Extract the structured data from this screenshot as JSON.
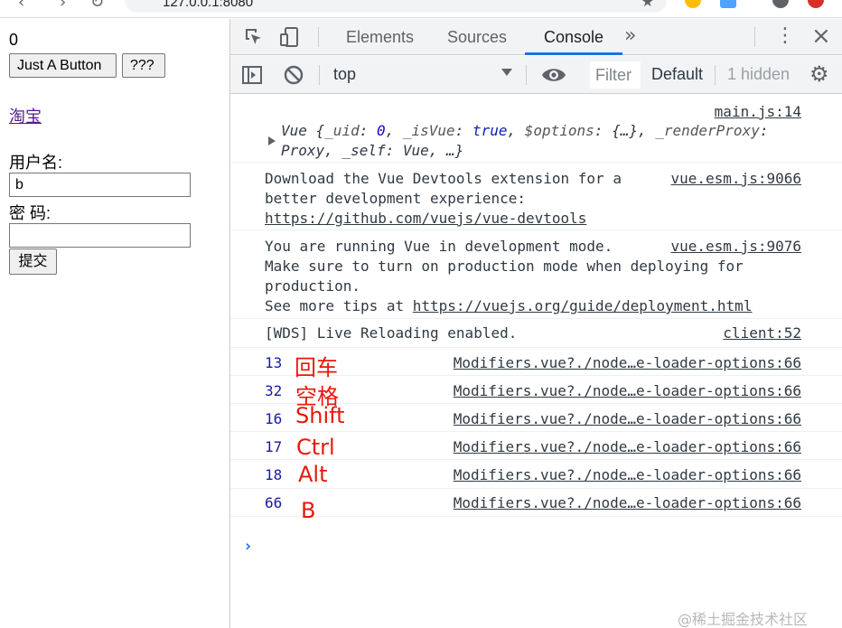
{
  "browser": {
    "url": "127.0.0.1:8080"
  },
  "page": {
    "counter": "0",
    "button1_label": "Just A Button",
    "button2_label": "???",
    "link_text": "淘宝",
    "username_label": "用户名:",
    "username_value": "b",
    "password_label": "密 码:",
    "password_value": "",
    "submit_label": "提交"
  },
  "devtools": {
    "tabs": [
      "Elements",
      "Sources",
      "Console"
    ],
    "active_tab": "Console",
    "context": "top",
    "filter_placeholder": "Filter",
    "levels": "Default levels",
    "hidden": "1 hidden"
  },
  "console": {
    "messages": [
      {
        "source": "main.js:14",
        "obj_line1": {
          "prefix": "Vue {",
          "k1": "_uid",
          "v1": "0",
          "k2": "_isVue",
          "v2": "true",
          "k3": "$options",
          "v3": "{…}",
          "k4": "_renderProxy"
        },
        "obj_line2": "Proxy, _self: Vue, …}"
      },
      {
        "source": "vue.esm.js:9066",
        "lines": [
          "Download the Vue Devtools extension for a",
          "better development experience:"
        ],
        "link": "https://github.com/vuejs/vue-devtools"
      },
      {
        "source": "vue.esm.js:9076",
        "lines": [
          "You are running Vue in development mode.",
          "Make sure to turn on production mode when deploying for",
          "production."
        ],
        "tip_prefix": "See more tips at",
        "link": "https://vuejs.org/guide/deployment.html"
      },
      {
        "source": "client:52",
        "text": "[WDS] Live Reloading enabled."
      }
    ],
    "key_logs": [
      {
        "code": "13",
        "annotation": "回车",
        "source": "Modifiers.vue?./node…e-loader-options:66"
      },
      {
        "code": "32",
        "annotation": "空格",
        "source": "Modifiers.vue?./node…e-loader-options:66"
      },
      {
        "code": "16",
        "annotation": "Shift",
        "source": "Modifiers.vue?./node…e-loader-options:66"
      },
      {
        "code": "17",
        "annotation": "Ctrl",
        "source": "Modifiers.vue?./node…e-loader-options:66"
      },
      {
        "code": "18",
        "annotation": "Alt",
        "source": "Modifiers.vue?./node…e-loader-options:66"
      },
      {
        "code": "66",
        "annotation": "B",
        "source": "Modifiers.vue?./node…e-loader-options:66"
      }
    ]
  },
  "watermark": "@稀土掘金技术社区",
  "colors": {
    "annotation": "#e8180a",
    "keycode": "#1a1aa6",
    "active_tab_underline": "#1a73e8",
    "link_visited": "#551a8b"
  },
  "icons": [
    "back-icon",
    "forward-icon",
    "reload-icon",
    "star-icon",
    "inspect-icon",
    "device-toggle-icon",
    "more-tabs-icon",
    "kebab-menu-icon",
    "close-icon",
    "sidebar-toggle-icon",
    "clear-console-icon",
    "eye-icon",
    "gear-icon",
    "prompt-chevron-icon"
  ]
}
